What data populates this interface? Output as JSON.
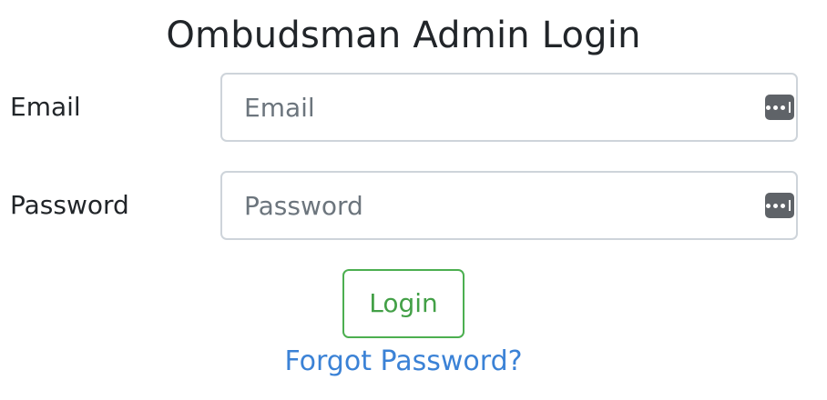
{
  "page": {
    "title": "Ombudsman Admin Login"
  },
  "form": {
    "email": {
      "label": "Email",
      "value": "",
      "placeholder": "Email"
    },
    "password": {
      "label": "Password",
      "value": "",
      "placeholder": "Password"
    },
    "login_label": "Login",
    "forgot_label": "Forgot Password?"
  },
  "icons": {
    "password_manager": "password-manager-icon"
  },
  "colors": {
    "text": "#212529",
    "placeholder": "#6c757d",
    "input_border": "#ced4da",
    "login_accent": "#43a047",
    "link": "#3b82d6",
    "icon_bg": "#5f6368"
  }
}
